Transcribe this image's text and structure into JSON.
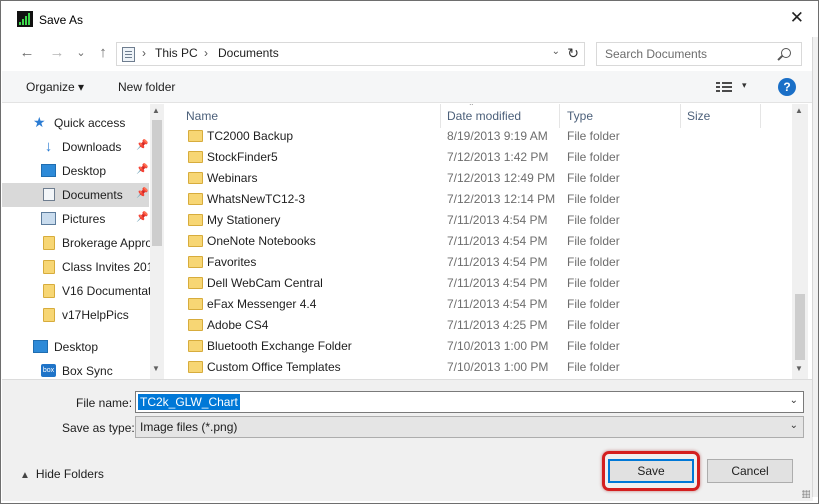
{
  "window": {
    "title": "Save As",
    "close_symbol": "✕"
  },
  "nav": {
    "back": "←",
    "forward": "→",
    "recent": "⌄",
    "up": "↑"
  },
  "address": {
    "crumbs": [
      "This PC",
      "Documents"
    ],
    "separator": "›",
    "dropdown": "⌄",
    "refresh": "↻"
  },
  "search": {
    "placeholder": "Search Documents"
  },
  "toolbar": {
    "organize": "Organize ▾",
    "new_folder": "New folder",
    "view_drop": "▾",
    "help": "?"
  },
  "sidebar": {
    "items": [
      {
        "label": "Quick access",
        "icon": "star-icon"
      },
      {
        "label": "Downloads",
        "icon": "download-icon",
        "pinned": true
      },
      {
        "label": "Desktop",
        "icon": "desktop-icon",
        "pinned": true
      },
      {
        "label": "Documents",
        "icon": "documents-icon",
        "pinned": true,
        "selected": true
      },
      {
        "label": "Pictures",
        "icon": "pictures-icon",
        "pinned": true
      },
      {
        "label": "Brokerage Appro",
        "icon": "folder-icon"
      },
      {
        "label": "Class Invites 201",
        "icon": "folder-icon"
      },
      {
        "label": "V16 Documentat",
        "icon": "folder-icon"
      },
      {
        "label": "v17HelpPics",
        "icon": "folder-icon"
      },
      {
        "label": "Desktop",
        "icon": "desktop-icon"
      },
      {
        "label": "Box Sync",
        "icon": "box-icon"
      }
    ],
    "pin_symbol": "📌"
  },
  "columns": [
    "Name",
    "Date modified",
    "Type",
    "Size"
  ],
  "files": [
    {
      "name": "TC2000 Backup",
      "date": "8/19/2013 9:19 AM",
      "type": "File folder"
    },
    {
      "name": "StockFinder5",
      "date": "7/12/2013 1:42 PM",
      "type": "File folder"
    },
    {
      "name": "Webinars",
      "date": "7/12/2013 12:49 PM",
      "type": "File folder"
    },
    {
      "name": "WhatsNewTC12-3",
      "date": "7/12/2013 12:14 PM",
      "type": "File folder"
    },
    {
      "name": "My Stationery",
      "date": "7/11/2013 4:54 PM",
      "type": "File folder"
    },
    {
      "name": "OneNote Notebooks",
      "date": "7/11/2013 4:54 PM",
      "type": "File folder"
    },
    {
      "name": "Favorites",
      "date": "7/11/2013 4:54 PM",
      "type": "File folder"
    },
    {
      "name": "Dell WebCam Central",
      "date": "7/11/2013 4:54 PM",
      "type": "File folder"
    },
    {
      "name": "eFax Messenger 4.4",
      "date": "7/11/2013 4:54 PM",
      "type": "File folder"
    },
    {
      "name": "Adobe CS4",
      "date": "7/11/2013 4:25 PM",
      "type": "File folder"
    },
    {
      "name": "Bluetooth Exchange Folder",
      "date": "7/10/2013 1:00 PM",
      "type": "File folder"
    },
    {
      "name": "Custom Office Templates",
      "date": "7/10/2013 1:00 PM",
      "type": "File folder"
    }
  ],
  "form": {
    "file_name_label": "File name:",
    "file_name_value": "TC2k_GLW_Chart",
    "save_type_label": "Save as type:",
    "save_type_value": "Image files (*.png)",
    "dropdown": "⌄"
  },
  "footer": {
    "hide_folders": "Hide Folders",
    "hide_caret": "▲",
    "save": "Save",
    "cancel": "Cancel"
  },
  "colors": {
    "accent": "#0078d7",
    "highlight_ring": "#d41f1f",
    "folder": "#f7d674"
  }
}
